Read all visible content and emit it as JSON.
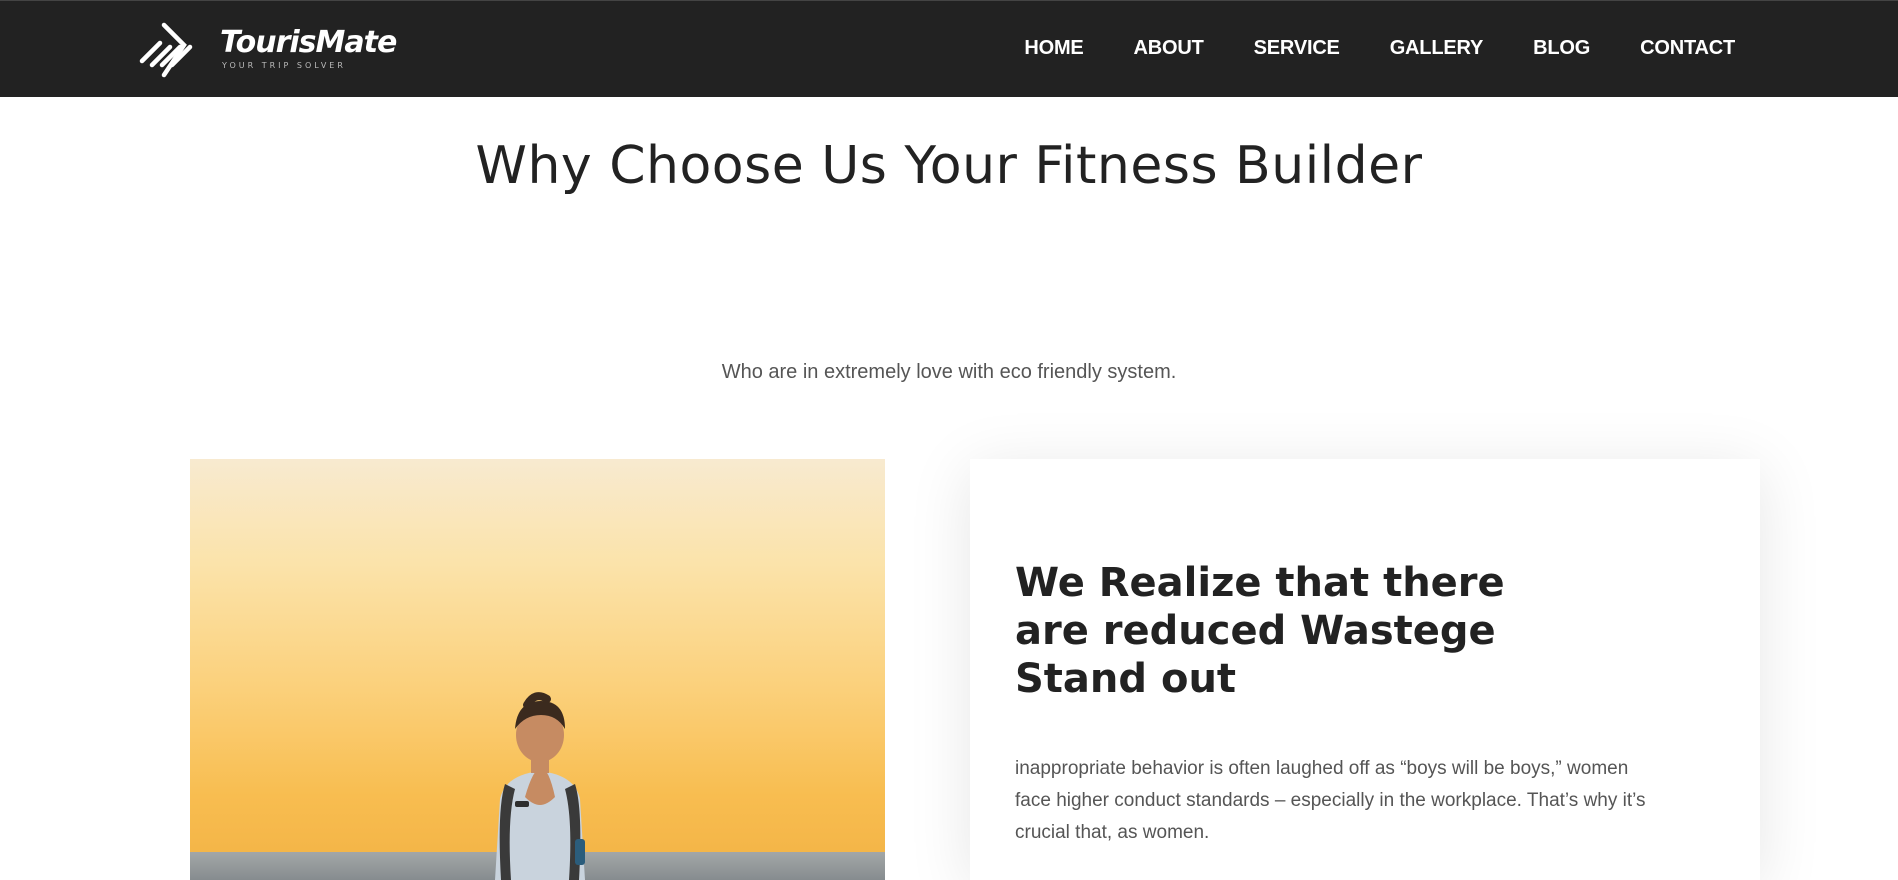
{
  "brand": {
    "name": "TourisMate",
    "tagline": "YOUR TRIP SOLVER"
  },
  "nav": {
    "items": [
      {
        "label": "HOME"
      },
      {
        "label": "ABOUT"
      },
      {
        "label": "SERVICE"
      },
      {
        "label": "GALLERY"
      },
      {
        "label": "BLOG"
      },
      {
        "label": "CONTACT"
      }
    ]
  },
  "section": {
    "heading": "Why Choose Us Your Fitness Builder",
    "subtitle": "Who are in extremely love with eco friendly system."
  },
  "feature": {
    "image": "sunset-beach-person-photo",
    "title": "We Realize that there are reduced Wastege Stand out",
    "text": "inappropriate behavior is often laughed off as “boys will be boys,” women face higher conduct standards – especially in the workplace. That’s why it’s crucial that, as women."
  },
  "colors": {
    "header_bg": "#222222",
    "heading": "#222222",
    "body_text": "#555555"
  }
}
